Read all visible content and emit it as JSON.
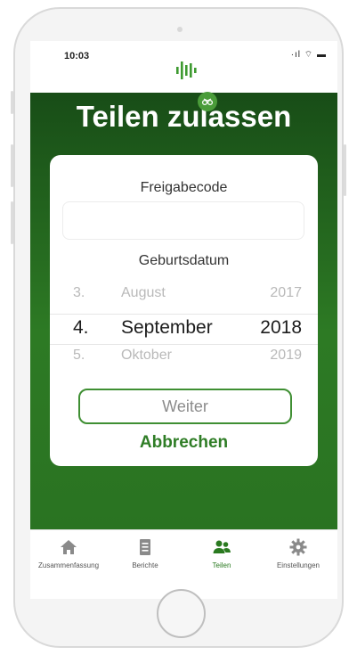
{
  "status_bar": {
    "time": "10:03",
    "icons": "·ıl ⌔ ▬"
  },
  "header": {
    "title": "Teilen zulassen"
  },
  "form": {
    "share_code_label": "Freigabecode",
    "share_code_value": "",
    "share_code_placeholder": "",
    "birthdate_label": "Geburtsdatum",
    "picker": {
      "above": {
        "day": "3.",
        "month": "August",
        "year": "2017"
      },
      "selected": {
        "day": "4.",
        "month": "September",
        "year": "2018"
      },
      "below": {
        "day": "5.",
        "month": "Oktober",
        "year": "2019"
      }
    },
    "next_label": "Weiter",
    "cancel_label": "Abbrechen"
  },
  "tabs": [
    {
      "label": "Zusammenfassung",
      "icon": "home-icon",
      "active": false
    },
    {
      "label": "Berichte",
      "icon": "document-icon",
      "active": false
    },
    {
      "label": "Teilen",
      "icon": "people-icon",
      "active": true
    },
    {
      "label": "Einstellungen",
      "icon": "gear-icon",
      "active": false
    }
  ],
  "colors": {
    "brand_green": "#2a7a20",
    "header_gradient_top": "#184d17",
    "header_gradient_bottom": "#2d7a24",
    "inactive_icon": "#8a8a8a"
  }
}
